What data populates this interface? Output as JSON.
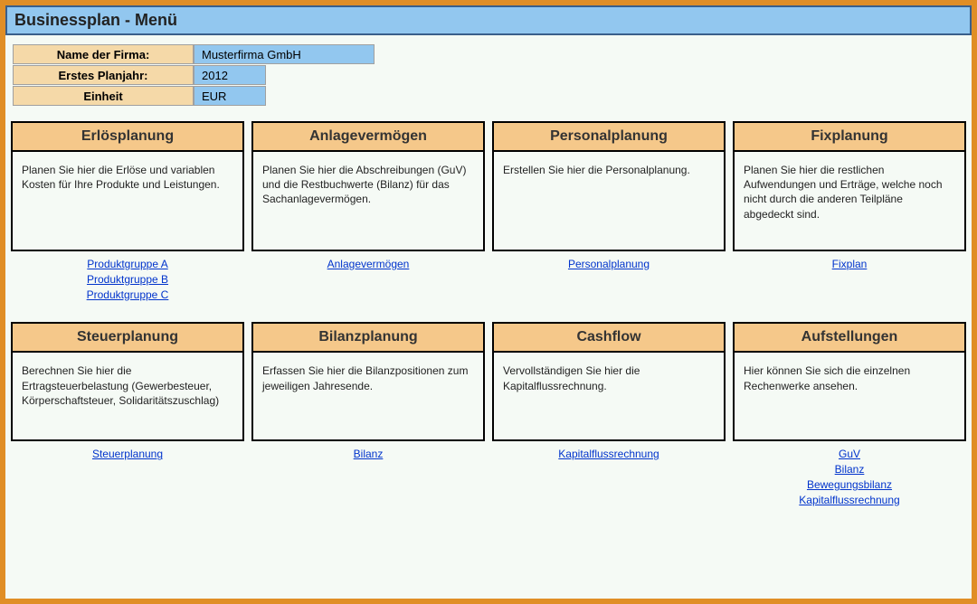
{
  "title": "Businessplan - Menü",
  "meta": {
    "name_label": "Name der Firma:",
    "name_value": "Musterfirma GmbH",
    "year_label": "Erstes Planjahr:",
    "year_value": "2012",
    "unit_label": "Einheit",
    "unit_value": "EUR"
  },
  "row1": {
    "c1": {
      "title": "Erlösplanung",
      "desc": "Planen Sie hier die Erlöse und variablen Kosten für Ihre Produkte und Leistungen.",
      "links": [
        "Produktgruppe A",
        "Produktgruppe B",
        "Produktgruppe C"
      ]
    },
    "c2": {
      "title": "Anlagevermögen",
      "desc": "Planen Sie hier die Abschreibungen (GuV) und die Restbuchwerte (Bilanz) für das Sachanlagevermögen.",
      "links": [
        "Anlagevermögen"
      ]
    },
    "c3": {
      "title": "Personalplanung",
      "desc": "Erstellen Sie hier die Personalplanung.",
      "links": [
        "Personalplanung"
      ]
    },
    "c4": {
      "title": "Fixplanung",
      "desc": "Planen Sie hier die restlichen Aufwendungen und Erträge, welche noch nicht durch die anderen Teilpläne abgedeckt sind.",
      "links": [
        "Fixplan"
      ]
    }
  },
  "row2": {
    "c1": {
      "title": "Steuerplanung",
      "desc": "Berechnen Sie hier die Ertragsteuerbelastung (Gewerbesteuer, Körperschaftsteuer, Solidaritätszuschlag)",
      "links": [
        "Steuerplanung"
      ]
    },
    "c2": {
      "title": "Bilanzplanung",
      "desc": "Erfassen Sie hier die Bilanzpositionen zum jeweiligen Jahresende.",
      "links": [
        "Bilanz"
      ]
    },
    "c3": {
      "title": "Cashflow",
      "desc": "Vervollständigen Sie hier die Kapitalflussrechnung.",
      "links": [
        "Kapitalflussrechnung"
      ]
    },
    "c4": {
      "title": "Aufstellungen",
      "desc": "Hier können Sie sich die einzelnen Rechenwerke ansehen.",
      "links": [
        "GuV",
        "Bilanz",
        "Bewegungsbilanz",
        "Kapitalflussrechnung"
      ]
    }
  }
}
